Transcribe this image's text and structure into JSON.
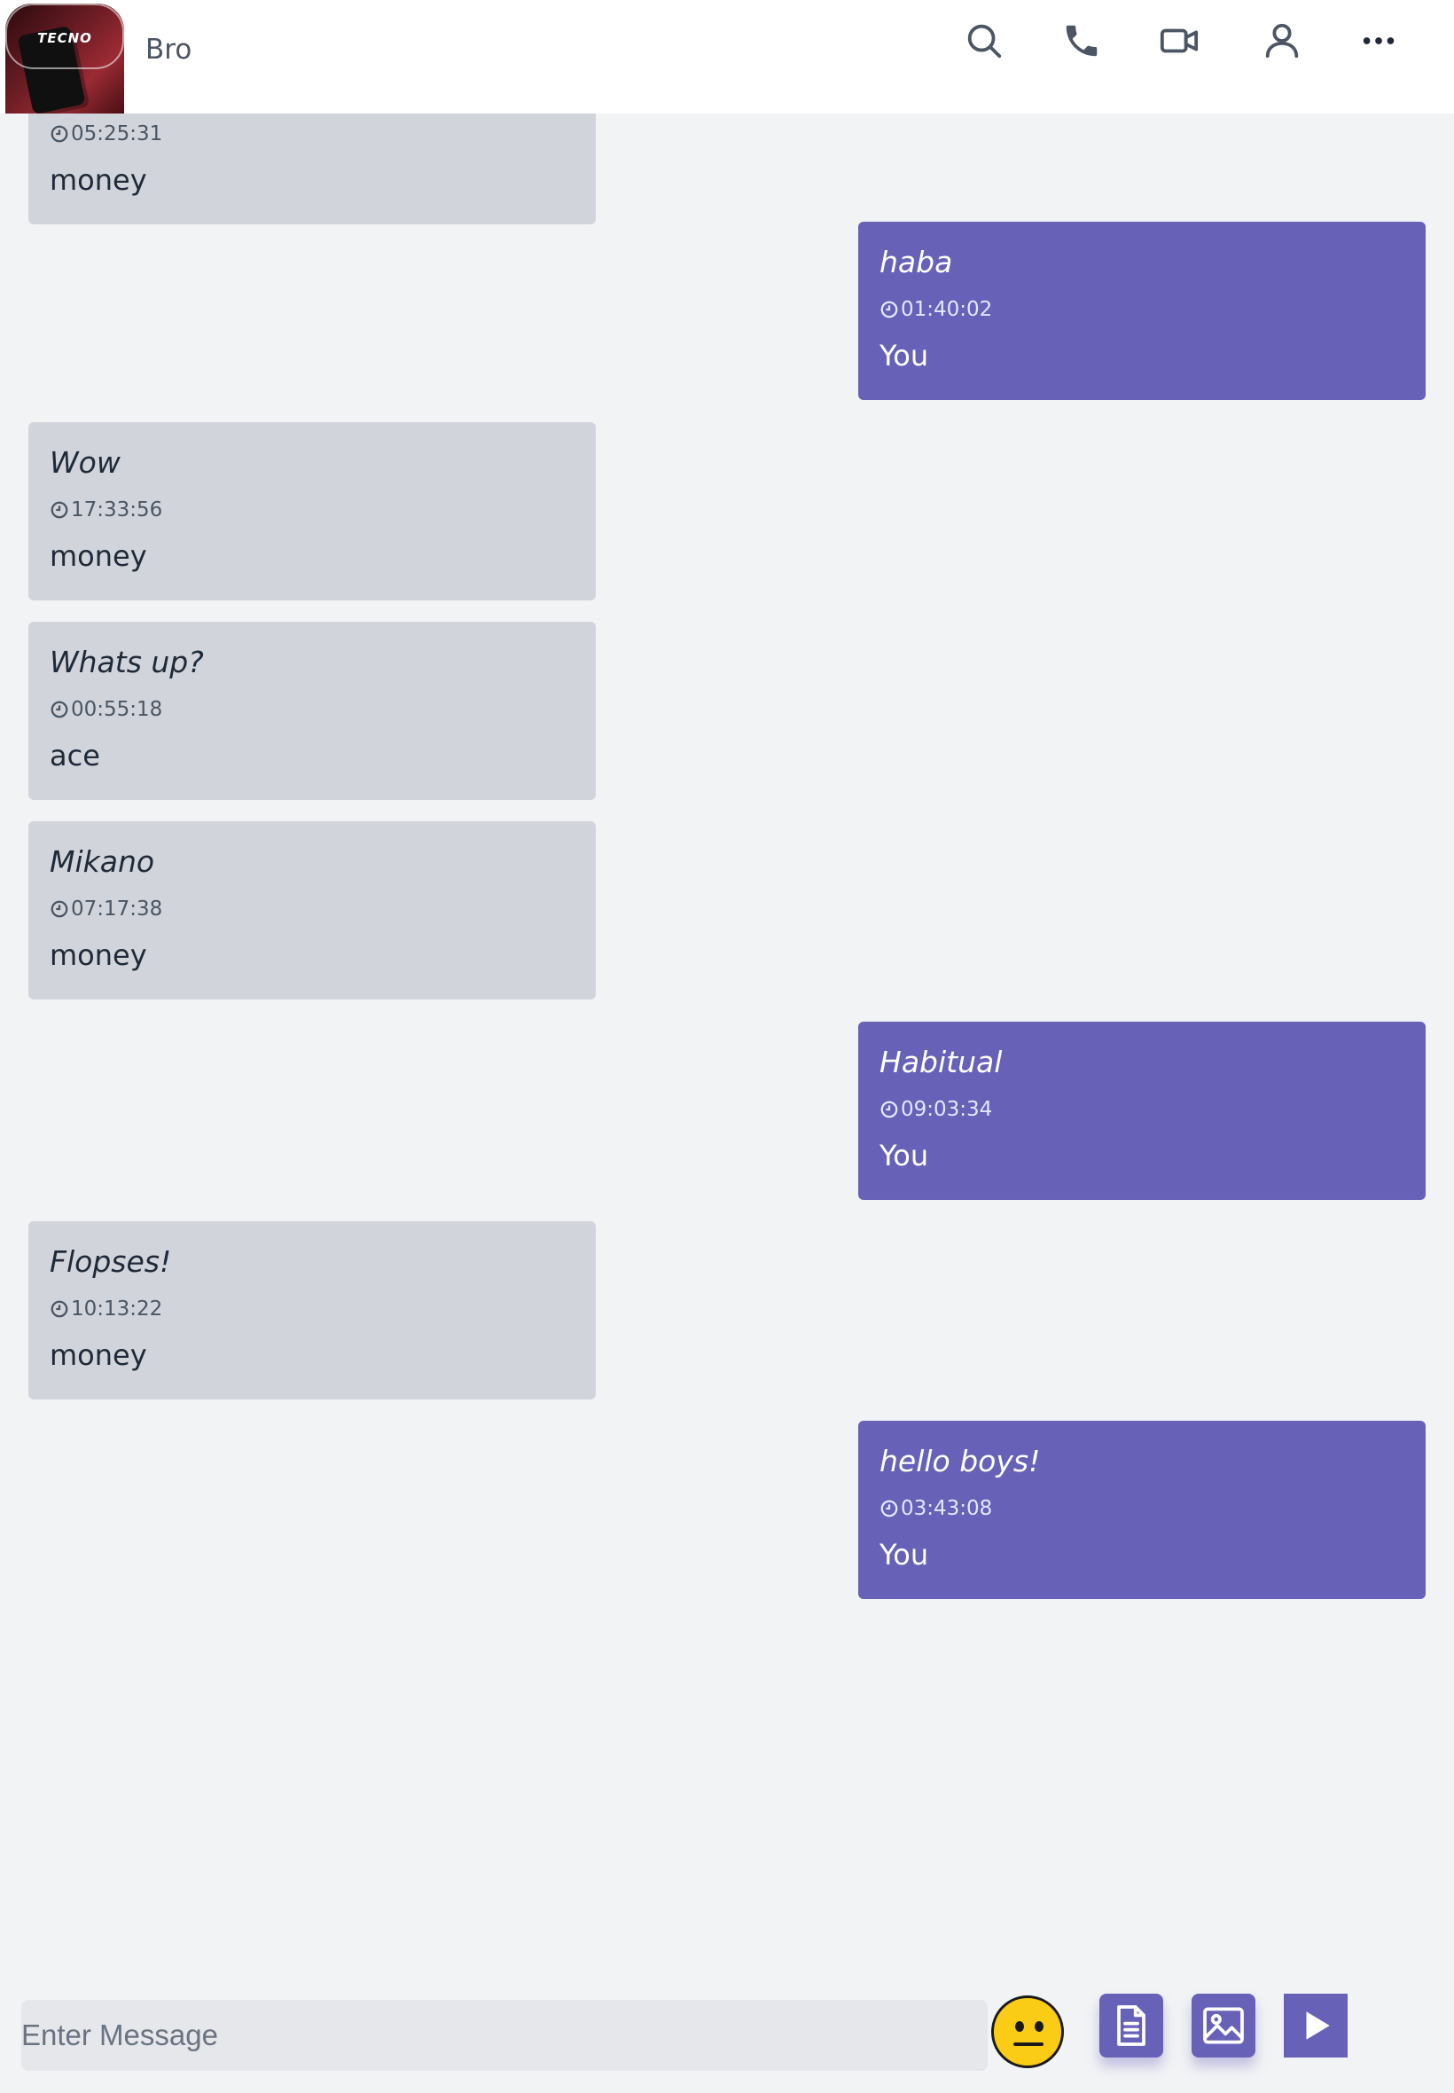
{
  "header": {
    "contact_name": "Bro",
    "avatar_brand": "TECNO",
    "icons": [
      "search-icon",
      "phone-icon",
      "video-icon",
      "user-icon",
      "more-icon"
    ]
  },
  "messages": [
    {
      "text": "",
      "time": "05:25:31",
      "sender": "money",
      "direction": "in"
    },
    {
      "text": "haba",
      "time": "01:40:02",
      "sender": "You",
      "direction": "out"
    },
    {
      "text": "Wow",
      "time": "17:33:56",
      "sender": "money",
      "direction": "in"
    },
    {
      "text": "Whats up?",
      "time": "00:55:18",
      "sender": "ace",
      "direction": "in"
    },
    {
      "text": "Mikano",
      "time": "07:17:38",
      "sender": "money",
      "direction": "in"
    },
    {
      "text": "Habitual",
      "time": "09:03:34",
      "sender": "You",
      "direction": "out"
    },
    {
      "text": "Flopses!",
      "time": "10:13:22",
      "sender": "money",
      "direction": "in"
    },
    {
      "text": "hello boys!",
      "time": "03:43:08",
      "sender": "You",
      "direction": "out"
    }
  ],
  "composer": {
    "placeholder": "Enter Message",
    "buttons": [
      "emoji-icon",
      "document-icon",
      "image-icon",
      "send-icon"
    ]
  },
  "colors": {
    "outgoing_bubble": "#6761b8",
    "incoming_bubble": "#d1d5db",
    "background": "#f2f3f5",
    "emoji": "#facc15"
  }
}
